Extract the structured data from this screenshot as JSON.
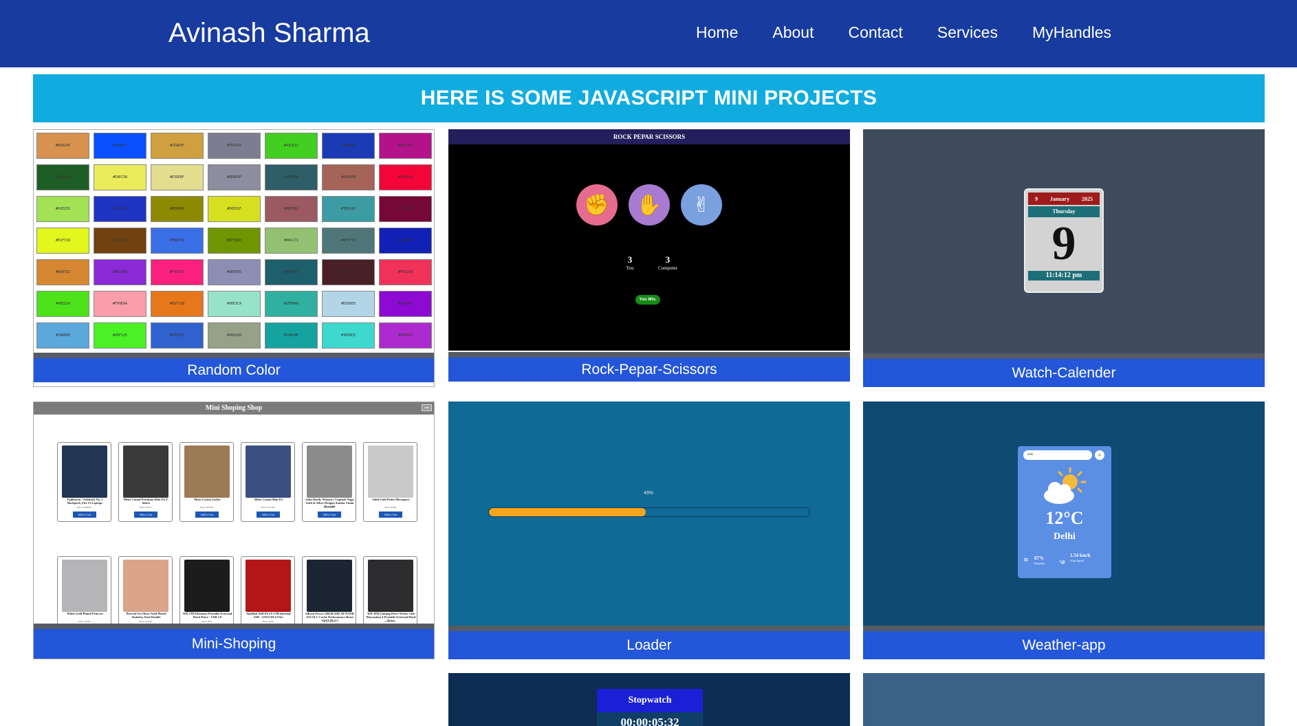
{
  "nav": {
    "brand": "Avinash Sharma",
    "links": [
      "Home",
      "About",
      "Contact",
      "Services",
      "MyHandles"
    ]
  },
  "banner": "HERE IS SOME JAVASCRIPT MINI PROJECTS",
  "projects": [
    {
      "caption": "Random Color"
    },
    {
      "caption": "Rock-Pepar-Scissors"
    },
    {
      "caption": "Watch-Calender"
    },
    {
      "caption": "Mini-Shoping"
    },
    {
      "caption": "Loader"
    },
    {
      "caption": "Weather-app"
    }
  ],
  "random_color": {
    "colors": [
      "#D6924E",
      "#0A50FF",
      "#CEA03F",
      "#7D7D92",
      "#43CE22",
      "#1B3BB6",
      "#B3128A",
      "#1E5E26",
      "#EAEC5B",
      "#E3DE8F",
      "#8D8D9F",
      "#2E5E68",
      "#A66458",
      "#F5043A",
      "#A3E255",
      "#1F34C2",
      "#8E8A00",
      "#D6E01F",
      "#9B5962",
      "#3D9CA3",
      "#760838",
      "#E1F71D",
      "#714110",
      "#3B6FE6",
      "#6F9500",
      "#94C171",
      "#4F7779",
      "#1120B5",
      "#D68732",
      "#8B2AD6",
      "#F9207E",
      "#8E8EB5",
      "#1E5F6C",
      "#492026",
      "#F0325B",
      "#4DE21A",
      "#F99EAA",
      "#E6771B",
      "#96E3CA",
      "#2FB0A0",
      "#B2D6E8",
      "#8D0AD3",
      "#5BA8DD",
      "#49F125",
      "#2F62CE",
      "#96A188",
      "#14A39E",
      "#3ED8CE",
      "#AD2ACE"
    ]
  },
  "rps": {
    "title": "ROCK PEPAR SCISSORS",
    "you_score": "3",
    "you_label": "You",
    "computer_score": "3",
    "computer_label": "Computer",
    "result": "You Win."
  },
  "calendar": {
    "day": "9",
    "month": "January",
    "year": "2025",
    "weekday": "Thursday",
    "date": "9",
    "time": "11:14:12 pm"
  },
  "shop": {
    "title": "Mini Shoping Shop",
    "cart_label": "cart",
    "products": [
      {
        "name": "Fjallraven - Foldsack No. 1 Backpack, Fits 15 Laptops",
        "price": "Price: $109.95",
        "button": "Add to Cart",
        "color": "#223552"
      },
      {
        "name": "Mens Casual Premium Slim Fit T-Shirts",
        "price": "Price: $22.3",
        "button": "Add to Cart",
        "color": "#3a3a3a"
      },
      {
        "name": "Mens Cotton Jacket",
        "price": "Price: $55.99",
        "button": "Add to Cart",
        "color": "#9c7a55"
      },
      {
        "name": "Mens Casual Slim Fit",
        "price": "Price: $15.99",
        "button": "Add to Cart",
        "color": "#3b4f80"
      },
      {
        "name": "John Hardy Women's Legends Naga Gold & Silver Dragon Station Chain Bracelet",
        "price": "Price: $695",
        "button": "Add to Cart",
        "color": "#8c8c8c"
      },
      {
        "name": "Solid Gold Petite Micropave",
        "price": "Price: $168",
        "button": "Add to Cart",
        "color": "#c9c9c9"
      },
      {
        "name": "White Gold Plated Princess",
        "price": "Price: $9.99",
        "button": "Add to Cart",
        "color": "#b5b5b8"
      },
      {
        "name": "Pierced Owl Rose Gold Plated Stainless Steel Double",
        "price": "Price: $10.99",
        "button": "Add to Cart",
        "color": "#d9a48a"
      },
      {
        "name": "WD 2TB Elements Portable External Hard Drive - USB 3.0",
        "price": "Price: $64",
        "button": "Add to Cart",
        "color": "#1c1c1c"
      },
      {
        "name": "SanDisk SSD PLUS 1TB Internal SSD - SATA III 6 Gb/s",
        "price": "Price: $109",
        "button": "Add to Cart",
        "color": "#b31616"
      },
      {
        "name": "Silicon Power 256GB SSD 3D NAND A55 SLC Cache Performance Boost SATA III 2.5",
        "price": "Price: $109",
        "button": "Add to Cart",
        "color": "#1c2633"
      },
      {
        "name": "WD 4TB Gaming Drive Works with Playstation 4 Portable External Hard Drive",
        "price": "Price: $114",
        "button": "Add to Cart",
        "color": "#2d2d30"
      }
    ]
  },
  "loader": {
    "percent_label": "49%",
    "progress": 0.49
  },
  "weather": {
    "search_value": "dehi",
    "temperature": "12°C",
    "city": "Delhi",
    "humidity": "87%",
    "humidity_label": "Humidity",
    "wind": "1.54 km/h",
    "wind_label": "Wind Speed"
  },
  "stopwatch": {
    "title": "Stopwatch",
    "time": "00:00:05:32"
  },
  "colors": {
    "nav_bg": "#173b9e",
    "banner_bg": "#10ace0",
    "caption_bg": "#2356d8"
  }
}
